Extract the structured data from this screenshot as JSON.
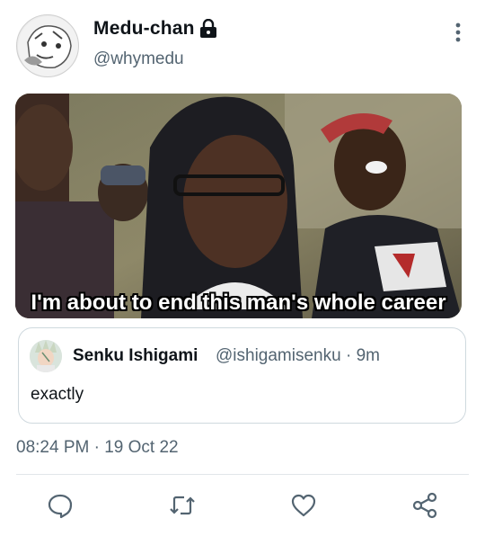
{
  "tweet": {
    "display_name": "Medu-chan",
    "handle": "@whymedu",
    "locked": true,
    "media_caption": "I'm about to end this man's whole career",
    "timestamp": "08:24 PM · 19 Oct 22"
  },
  "quoted_tweet": {
    "display_name": "Senku Ishigami",
    "meta": "@ishigamisenku · 9m",
    "text": "exactly"
  },
  "actions": [
    {
      "icon": "reply-icon"
    },
    {
      "icon": "retweet-icon"
    },
    {
      "icon": "like-icon"
    },
    {
      "icon": "share-icon"
    }
  ],
  "colors": {
    "text": "#0f1419",
    "secondary_text": "#536471",
    "border": "#cfd9de",
    "icon": "#536471"
  }
}
